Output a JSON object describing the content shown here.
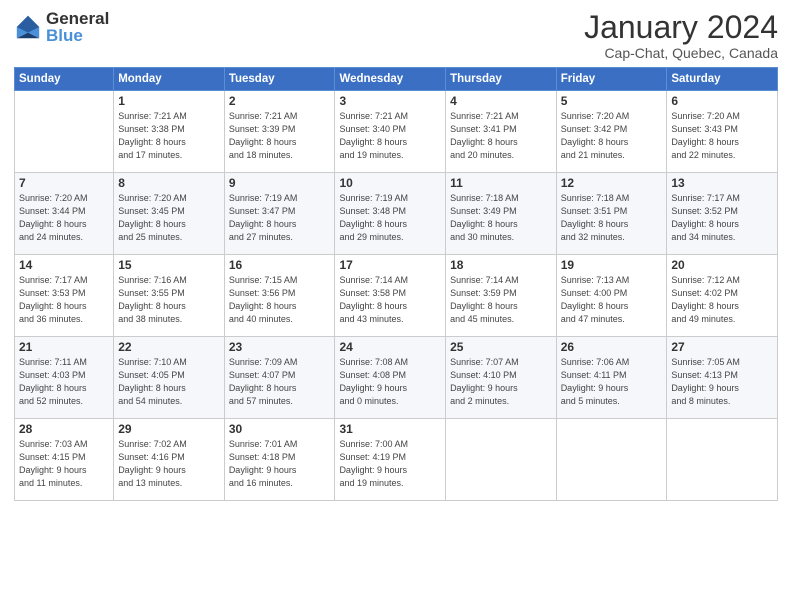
{
  "header": {
    "logo_general": "General",
    "logo_blue": "Blue",
    "month_title": "January 2024",
    "location": "Cap-Chat, Quebec, Canada"
  },
  "days_of_week": [
    "Sunday",
    "Monday",
    "Tuesday",
    "Wednesday",
    "Thursday",
    "Friday",
    "Saturday"
  ],
  "weeks": [
    [
      {
        "day": "",
        "info": ""
      },
      {
        "day": "1",
        "info": "Sunrise: 7:21 AM\nSunset: 3:38 PM\nDaylight: 8 hours\nand 17 minutes."
      },
      {
        "day": "2",
        "info": "Sunrise: 7:21 AM\nSunset: 3:39 PM\nDaylight: 8 hours\nand 18 minutes."
      },
      {
        "day": "3",
        "info": "Sunrise: 7:21 AM\nSunset: 3:40 PM\nDaylight: 8 hours\nand 19 minutes."
      },
      {
        "day": "4",
        "info": "Sunrise: 7:21 AM\nSunset: 3:41 PM\nDaylight: 8 hours\nand 20 minutes."
      },
      {
        "day": "5",
        "info": "Sunrise: 7:20 AM\nSunset: 3:42 PM\nDaylight: 8 hours\nand 21 minutes."
      },
      {
        "day": "6",
        "info": "Sunrise: 7:20 AM\nSunset: 3:43 PM\nDaylight: 8 hours\nand 22 minutes."
      }
    ],
    [
      {
        "day": "7",
        "info": "Sunrise: 7:20 AM\nSunset: 3:44 PM\nDaylight: 8 hours\nand 24 minutes."
      },
      {
        "day": "8",
        "info": "Sunrise: 7:20 AM\nSunset: 3:45 PM\nDaylight: 8 hours\nand 25 minutes."
      },
      {
        "day": "9",
        "info": "Sunrise: 7:19 AM\nSunset: 3:47 PM\nDaylight: 8 hours\nand 27 minutes."
      },
      {
        "day": "10",
        "info": "Sunrise: 7:19 AM\nSunset: 3:48 PM\nDaylight: 8 hours\nand 29 minutes."
      },
      {
        "day": "11",
        "info": "Sunrise: 7:18 AM\nSunset: 3:49 PM\nDaylight: 8 hours\nand 30 minutes."
      },
      {
        "day": "12",
        "info": "Sunrise: 7:18 AM\nSunset: 3:51 PM\nDaylight: 8 hours\nand 32 minutes."
      },
      {
        "day": "13",
        "info": "Sunrise: 7:17 AM\nSunset: 3:52 PM\nDaylight: 8 hours\nand 34 minutes."
      }
    ],
    [
      {
        "day": "14",
        "info": "Sunrise: 7:17 AM\nSunset: 3:53 PM\nDaylight: 8 hours\nand 36 minutes."
      },
      {
        "day": "15",
        "info": "Sunrise: 7:16 AM\nSunset: 3:55 PM\nDaylight: 8 hours\nand 38 minutes."
      },
      {
        "day": "16",
        "info": "Sunrise: 7:15 AM\nSunset: 3:56 PM\nDaylight: 8 hours\nand 40 minutes."
      },
      {
        "day": "17",
        "info": "Sunrise: 7:14 AM\nSunset: 3:58 PM\nDaylight: 8 hours\nand 43 minutes."
      },
      {
        "day": "18",
        "info": "Sunrise: 7:14 AM\nSunset: 3:59 PM\nDaylight: 8 hours\nand 45 minutes."
      },
      {
        "day": "19",
        "info": "Sunrise: 7:13 AM\nSunset: 4:00 PM\nDaylight: 8 hours\nand 47 minutes."
      },
      {
        "day": "20",
        "info": "Sunrise: 7:12 AM\nSunset: 4:02 PM\nDaylight: 8 hours\nand 49 minutes."
      }
    ],
    [
      {
        "day": "21",
        "info": "Sunrise: 7:11 AM\nSunset: 4:03 PM\nDaylight: 8 hours\nand 52 minutes."
      },
      {
        "day": "22",
        "info": "Sunrise: 7:10 AM\nSunset: 4:05 PM\nDaylight: 8 hours\nand 54 minutes."
      },
      {
        "day": "23",
        "info": "Sunrise: 7:09 AM\nSunset: 4:07 PM\nDaylight: 8 hours\nand 57 minutes."
      },
      {
        "day": "24",
        "info": "Sunrise: 7:08 AM\nSunset: 4:08 PM\nDaylight: 9 hours\nand 0 minutes."
      },
      {
        "day": "25",
        "info": "Sunrise: 7:07 AM\nSunset: 4:10 PM\nDaylight: 9 hours\nand 2 minutes."
      },
      {
        "day": "26",
        "info": "Sunrise: 7:06 AM\nSunset: 4:11 PM\nDaylight: 9 hours\nand 5 minutes."
      },
      {
        "day": "27",
        "info": "Sunrise: 7:05 AM\nSunset: 4:13 PM\nDaylight: 9 hours\nand 8 minutes."
      }
    ],
    [
      {
        "day": "28",
        "info": "Sunrise: 7:03 AM\nSunset: 4:15 PM\nDaylight: 9 hours\nand 11 minutes."
      },
      {
        "day": "29",
        "info": "Sunrise: 7:02 AM\nSunset: 4:16 PM\nDaylight: 9 hours\nand 13 minutes."
      },
      {
        "day": "30",
        "info": "Sunrise: 7:01 AM\nSunset: 4:18 PM\nDaylight: 9 hours\nand 16 minutes."
      },
      {
        "day": "31",
        "info": "Sunrise: 7:00 AM\nSunset: 4:19 PM\nDaylight: 9 hours\nand 19 minutes."
      },
      {
        "day": "",
        "info": ""
      },
      {
        "day": "",
        "info": ""
      },
      {
        "day": "",
        "info": ""
      }
    ]
  ]
}
